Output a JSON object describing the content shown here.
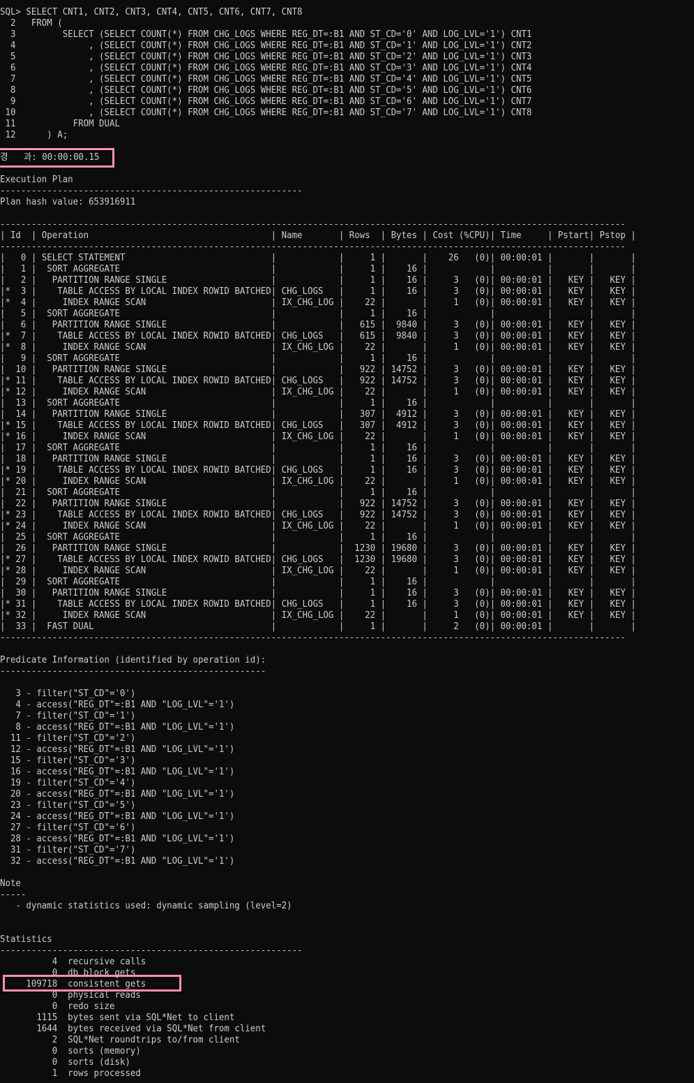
{
  "window": {
    "background": "#0c0c0c",
    "text_color": "#cccccc",
    "highlight_color": "#ff8fb0"
  },
  "terminal": {
    "lines": [
      "SQL> SELECT CNT1, CNT2, CNT3, CNT4, CNT5, CNT6, CNT7, CNT8",
      "  2   FROM (",
      "  3         SELECT (SELECT COUNT(*) FROM CHG_LOGS WHERE REG_DT=:B1 AND ST_CD='0' AND LOG_LVL='1') CNT1",
      "  4              , (SELECT COUNT(*) FROM CHG_LOGS WHERE REG_DT=:B1 AND ST_CD='1' AND LOG_LVL='1') CNT2",
      "  5              , (SELECT COUNT(*) FROM CHG_LOGS WHERE REG_DT=:B1 AND ST_CD='2' AND LOG_LVL='1') CNT3",
      "  6              , (SELECT COUNT(*) FROM CHG_LOGS WHERE REG_DT=:B1 AND ST_CD='3' AND LOG_LVL='1') CNT4",
      "  7              , (SELECT COUNT(*) FROM CHG_LOGS WHERE REG_DT=:B1 AND ST_CD='4' AND LOG_LVL='1') CNT5",
      "  8              , (SELECT COUNT(*) FROM CHG_LOGS WHERE REG_DT=:B1 AND ST_CD='5' AND LOG_LVL='1') CNT6",
      "  9              , (SELECT COUNT(*) FROM CHG_LOGS WHERE REG_DT=:B1 AND ST_CD='6' AND LOG_LVL='1') CNT7",
      " 10              , (SELECT COUNT(*) FROM CHG_LOGS WHERE REG_DT=:B1 AND ST_CD='7' AND LOG_LVL='1') CNT8",
      " 11           FROM DUAL",
      " 12      ) A;",
      "",
      "경   과: 00:00:00.15",
      "",
      "Execution Plan",
      "----------------------------------------------------------",
      "Plan hash value: 653916911",
      "",
      "------------------------------------------------------------------------------------------------------------------------",
      "| Id  | Operation                                   | Name       | Rows  | Bytes | Cost (%CPU)| Time     | Pstart| Pstop |",
      "------------------------------------------------------------------------------------------------------------------------",
      "|   0 | SELECT STATEMENT                            |            |     1 |       |    26   (0)| 00:00:01 |       |       |",
      "|   1 |  SORT AGGREGATE                             |            |     1 |    16 |            |          |       |       |",
      "|   2 |   PARTITION RANGE SINGLE                    |            |     1 |    16 |     3   (0)| 00:00:01 |   KEY |   KEY |",
      "|*  3 |    TABLE ACCESS BY LOCAL INDEX ROWID BATCHED| CHG_LOGS   |     1 |    16 |     3   (0)| 00:00:01 |   KEY |   KEY |",
      "|*  4 |     INDEX RANGE SCAN                        | IX_CHG_LOG |    22 |       |     1   (0)| 00:00:01 |   KEY |   KEY |",
      "|   5 |  SORT AGGREGATE                             |            |     1 |    16 |            |          |       |       |",
      "|   6 |   PARTITION RANGE SINGLE                    |            |   615 |  9840 |     3   (0)| 00:00:01 |   KEY |   KEY |",
      "|*  7 |    TABLE ACCESS BY LOCAL INDEX ROWID BATCHED| CHG_LOGS   |   615 |  9840 |     3   (0)| 00:00:01 |   KEY |   KEY |",
      "|*  8 |     INDEX RANGE SCAN                        | IX_CHG_LOG |    22 |       |     1   (0)| 00:00:01 |   KEY |   KEY |",
      "|   9 |  SORT AGGREGATE                             |            |     1 |    16 |            |          |       |       |",
      "|  10 |   PARTITION RANGE SINGLE                    |            |   922 | 14752 |     3   (0)| 00:00:01 |   KEY |   KEY |",
      "|* 11 |    TABLE ACCESS BY LOCAL INDEX ROWID BATCHED| CHG_LOGS   |   922 | 14752 |     3   (0)| 00:00:01 |   KEY |   KEY |",
      "|* 12 |     INDEX RANGE SCAN                        | IX_CHG_LOG |    22 |       |     1   (0)| 00:00:01 |   KEY |   KEY |",
      "|  13 |  SORT AGGREGATE                             |            |     1 |    16 |            |          |       |       |",
      "|  14 |   PARTITION RANGE SINGLE                    |            |   307 |  4912 |     3   (0)| 00:00:01 |   KEY |   KEY |",
      "|* 15 |    TABLE ACCESS BY LOCAL INDEX ROWID BATCHED| CHG_LOGS   |   307 |  4912 |     3   (0)| 00:00:01 |   KEY |   KEY |",
      "|* 16 |     INDEX RANGE SCAN                        | IX_CHG_LOG |    22 |       |     1   (0)| 00:00:01 |   KEY |   KEY |",
      "|  17 |  SORT AGGREGATE                             |            |     1 |    16 |            |          |       |       |",
      "|  18 |   PARTITION RANGE SINGLE                    |            |     1 |    16 |     3   (0)| 00:00:01 |   KEY |   KEY |",
      "|* 19 |    TABLE ACCESS BY LOCAL INDEX ROWID BATCHED| CHG_LOGS   |     1 |    16 |     3   (0)| 00:00:01 |   KEY |   KEY |",
      "|* 20 |     INDEX RANGE SCAN                        | IX_CHG_LOG |    22 |       |     1   (0)| 00:00:01 |   KEY |   KEY |",
      "|  21 |  SORT AGGREGATE                             |            |     1 |    16 |            |          |       |       |",
      "|  22 |   PARTITION RANGE SINGLE                    |            |   922 | 14752 |     3   (0)| 00:00:01 |   KEY |   KEY |",
      "|* 23 |    TABLE ACCESS BY LOCAL INDEX ROWID BATCHED| CHG_LOGS   |   922 | 14752 |     3   (0)| 00:00:01 |   KEY |   KEY |",
      "|* 24 |     INDEX RANGE SCAN                        | IX_CHG_LOG |    22 |       |     1   (0)| 00:00:01 |   KEY |   KEY |",
      "|  25 |  SORT AGGREGATE                             |            |     1 |    16 |            |          |       |       |",
      "|  26 |   PARTITION RANGE SINGLE                    |            |  1230 | 19680 |     3   (0)| 00:00:01 |   KEY |   KEY |",
      "|* 27 |    TABLE ACCESS BY LOCAL INDEX ROWID BATCHED| CHG_LOGS   |  1230 | 19680 |     3   (0)| 00:00:01 |   KEY |   KEY |",
      "|* 28 |     INDEX RANGE SCAN                        | IX_CHG_LOG |    22 |       |     1   (0)| 00:00:01 |   KEY |   KEY |",
      "|  29 |  SORT AGGREGATE                             |            |     1 |    16 |            |          |       |       |",
      "|  30 |   PARTITION RANGE SINGLE                    |            |     1 |    16 |     3   (0)| 00:00:01 |   KEY |   KEY |",
      "|* 31 |    TABLE ACCESS BY LOCAL INDEX ROWID BATCHED| CHG_LOGS   |     1 |    16 |     3   (0)| 00:00:01 |   KEY |   KEY |",
      "|* 32 |     INDEX RANGE SCAN                        | IX_CHG_LOG |    22 |       |     1   (0)| 00:00:01 |   KEY |   KEY |",
      "|  33 |  FAST DUAL                                  |            |     1 |       |     2   (0)| 00:00:01 |       |       |",
      "------------------------------------------------------------------------------------------------------------------------",
      "",
      "Predicate Information (identified by operation id):",
      "---------------------------------------------------",
      "",
      "   3 - filter(\"ST_CD\"='0')",
      "   4 - access(\"REG_DT\"=:B1 AND \"LOG_LVL\"='1')",
      "   7 - filter(\"ST_CD\"='1')",
      "   8 - access(\"REG_DT\"=:B1 AND \"LOG_LVL\"='1')",
      "  11 - filter(\"ST_CD\"='2')",
      "  12 - access(\"REG_DT\"=:B1 AND \"LOG_LVL\"='1')",
      "  15 - filter(\"ST_CD\"='3')",
      "  16 - access(\"REG_DT\"=:B1 AND \"LOG_LVL\"='1')",
      "  19 - filter(\"ST_CD\"='4')",
      "  20 - access(\"REG_DT\"=:B1 AND \"LOG_LVL\"='1')",
      "  23 - filter(\"ST_CD\"='5')",
      "  24 - access(\"REG_DT\"=:B1 AND \"LOG_LVL\"='1')",
      "  27 - filter(\"ST_CD\"='6')",
      "  28 - access(\"REG_DT\"=:B1 AND \"LOG_LVL\"='1')",
      "  31 - filter(\"ST_CD\"='7')",
      "  32 - access(\"REG_DT\"=:B1 AND \"LOG_LVL\"='1')",
      "",
      "Note",
      "-----",
      "   - dynamic statistics used: dynamic sampling (level=2)",
      "",
      "",
      "Statistics",
      "----------------------------------------------------------",
      "          4  recursive calls",
      "          0  db block gets",
      "     109718  consistent gets",
      "          0  physical reads",
      "          0  redo size",
      "       1115  bytes sent via SQL*Net to client",
      "       1644  bytes received via SQL*Net from client",
      "          2  SQL*Net roundtrips to/from client",
      "          0  sorts (memory)",
      "          0  sorts (disk)",
      "          1  rows processed"
    ]
  }
}
